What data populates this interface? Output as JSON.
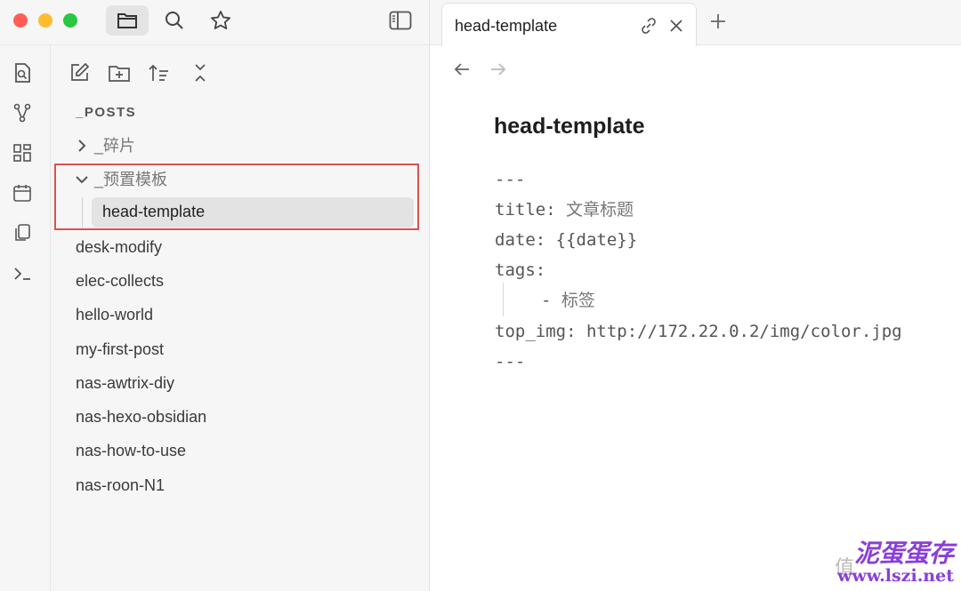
{
  "sidebar": {
    "root_label": "_POSTS",
    "folders": [
      {
        "label": "_碎片",
        "expanded": false
      },
      {
        "label": "_预置模板",
        "expanded": true
      }
    ],
    "selected_file": "head-template",
    "files": [
      "desk-modify",
      "elec-collects",
      "hello-world",
      "my-first-post",
      "nas-awtrix-diy",
      "nas-hexo-obsidian",
      "nas-how-to-use",
      "nas-roon-N1"
    ]
  },
  "tab": {
    "title": "head-template"
  },
  "note": {
    "title": "head-template",
    "front_matter_open": "---",
    "title_key": "title:",
    "title_value": "文章标题",
    "date_key": "date:",
    "date_value": "{{date}}",
    "tags_key": "tags:",
    "tag_item_dash": "-",
    "tag_item_value": "标签",
    "img_key": "top_img:",
    "img_value": "http://172.22.0.2/img/color.jpg",
    "front_matter_close": "---"
  },
  "watermark": {
    "line1": "值",
    "line2": "www.lszi.net",
    "brand": "泥蛋蛋存"
  },
  "colors": {
    "accent_box": "#d9534f",
    "selected_bg": "#e3e3e3"
  }
}
